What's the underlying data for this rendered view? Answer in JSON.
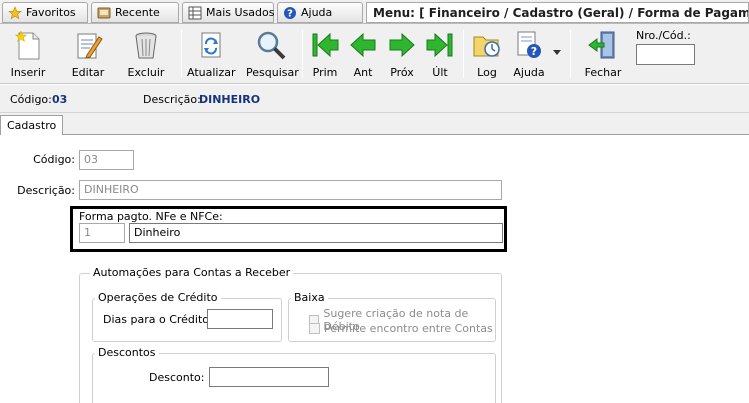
{
  "tabs": {
    "favoritos": "Favoritos",
    "recente": "Recente",
    "mais_usados": "Mais Usados",
    "ajuda": "Ajuda"
  },
  "menu_path": "Menu: [ Financeiro / Cadastro (Geral) / Forma de Pagamento ]",
  "toolbar": {
    "inserir": "Inserir",
    "editar": "Editar",
    "excluir": "Excluir",
    "atualizar": "Atualizar",
    "pesquisar": "Pesquisar",
    "prim": "Prim",
    "ant": "Ant",
    "prox": "Próx",
    "ult": "Últ",
    "log": "Log",
    "ajuda": "Ajuda",
    "fechar": "Fechar",
    "nro_cod_label": "Nro./Cód.:",
    "nro_cod_value": ""
  },
  "record": {
    "codigo_label": "Código:",
    "codigo_value": "03",
    "descricao_label": "Descrição:",
    "descricao_value": "DINHEIRO"
  },
  "inner_tab": "Cadastro",
  "form": {
    "codigo_label": "Código:",
    "codigo_value": "03",
    "descricao_label": "Descrição:",
    "descricao_value": "DINHEIRO",
    "nfe_caption": "Forma pagto. NFe e NFCe:",
    "nfe_code": "1",
    "nfe_desc": "Dinheiro",
    "automacoes_caption": "Automações para Contas a Receber",
    "operacoes_caption": "Operações de Crédito",
    "dias_label": "Dias para o Crédito:",
    "dias_value": "",
    "baixa_caption": "Baixa",
    "sugere_label": "Sugere criação de nota de Débito",
    "sugere_checked": false,
    "permite_label": "Permite encontro entre Contas",
    "permite_checked": false,
    "descontos_caption": "Descontos",
    "desconto_label": "Desconto:",
    "desconto_value": ""
  },
  "colors": {
    "record_value": "#18337a",
    "nav_green": "#2fb52f",
    "star_yellow": "#f1c21b",
    "help_blue": "#2458b8"
  },
  "icons": [
    "star-icon",
    "clock-icon",
    "grid-icon",
    "help-icon",
    "new-document-icon",
    "edit-icon",
    "trash-icon",
    "refresh-icon",
    "magnifier-icon",
    "first-icon",
    "previous-icon",
    "next-icon",
    "last-icon",
    "log-folder-icon",
    "help-document-icon",
    "exit-door-icon"
  ]
}
